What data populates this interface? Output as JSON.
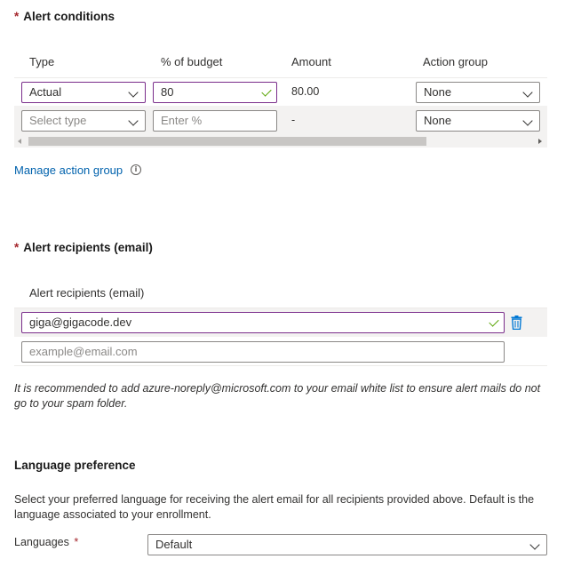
{
  "alert_conditions": {
    "title": "Alert conditions",
    "required_mark": "*",
    "columns": [
      "Type",
      "% of budget",
      "Amount",
      "Action group"
    ],
    "rows": [
      {
        "type": "Actual",
        "percent": "80",
        "amount": "80.00",
        "action_group": "None"
      },
      {
        "type_placeholder": "Select type",
        "percent_placeholder": "Enter %",
        "amount": "-",
        "action_group": "None"
      }
    ],
    "manage_link": "Manage action group",
    "info_glyph": "i"
  },
  "alert_recipients": {
    "title": "Alert recipients (email)",
    "required_mark": "*",
    "column": "Alert recipients (email)",
    "emails": [
      "giga@gigacode.dev"
    ],
    "new_email_placeholder": "example@email.com",
    "note": "It is recommended to add azure-noreply@microsoft.com to your email white list to ensure alert mails do not go to your spam folder."
  },
  "language": {
    "title": "Language preference",
    "description": "Select your preferred language for receiving the alert email for all recipients provided above. Default is the language associated to your enrollment.",
    "label": "Languages",
    "required_mark": "*",
    "value": "Default"
  },
  "colors": {
    "required": "#a4262c",
    "link": "#0062ad",
    "valid_border": "#7a2d8b",
    "valid_check": "#57a300",
    "trash": "#0078d4"
  },
  "icons": [
    "chevron-down-icon",
    "checkmark-icon",
    "info-icon",
    "trash-icon",
    "scroll-left-icon",
    "scroll-right-icon"
  ]
}
